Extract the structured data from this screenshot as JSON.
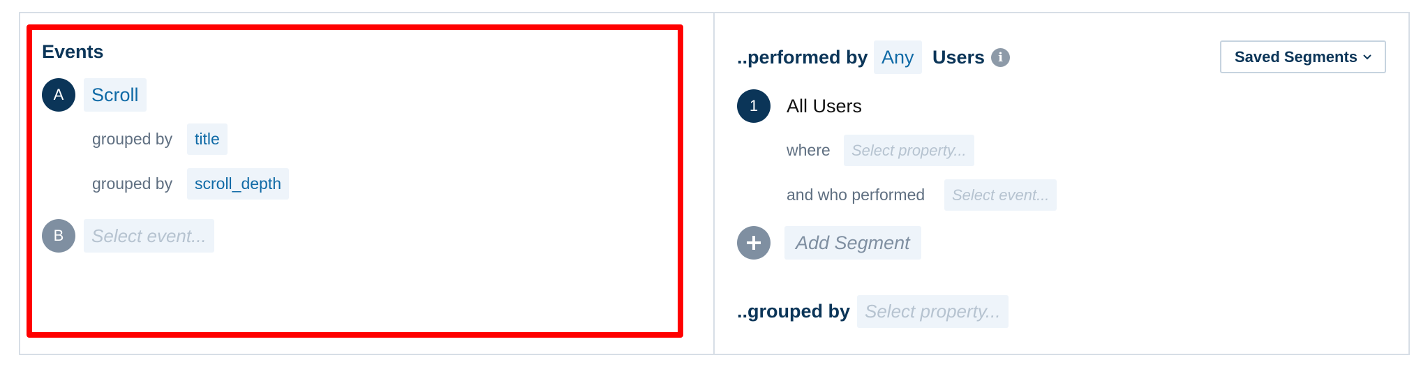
{
  "events": {
    "heading": "Events",
    "items": [
      {
        "badge": "A",
        "event": "Scroll",
        "groupings": [
          {
            "label": "grouped by",
            "property": "title"
          },
          {
            "label": "grouped by",
            "property": "scroll_depth"
          }
        ]
      },
      {
        "badge": "B",
        "placeholder": "Select event..."
      }
    ]
  },
  "segments": {
    "performed_by_label": "..performed by",
    "scope_value": "Any",
    "users_label": "Users",
    "info_icon": "info-icon",
    "saved_segments_label": "Saved Segments",
    "segment": {
      "badge": "1",
      "name": "All Users",
      "where_label": "where",
      "where_placeholder": "Select property...",
      "who_performed_label": "and who performed",
      "who_performed_placeholder": "Select event..."
    },
    "add_segment_label": "Add Segment",
    "grouped_by_label": "..grouped by",
    "grouped_by_placeholder": "Select property..."
  },
  "colors": {
    "navy": "#0b3558",
    "link_blue": "#0f6aa6",
    "chip_bg": "#eef4fa",
    "gray_badge": "#7f8fa1",
    "highlight_red": "#ff0000",
    "border": "#d7dee6"
  }
}
